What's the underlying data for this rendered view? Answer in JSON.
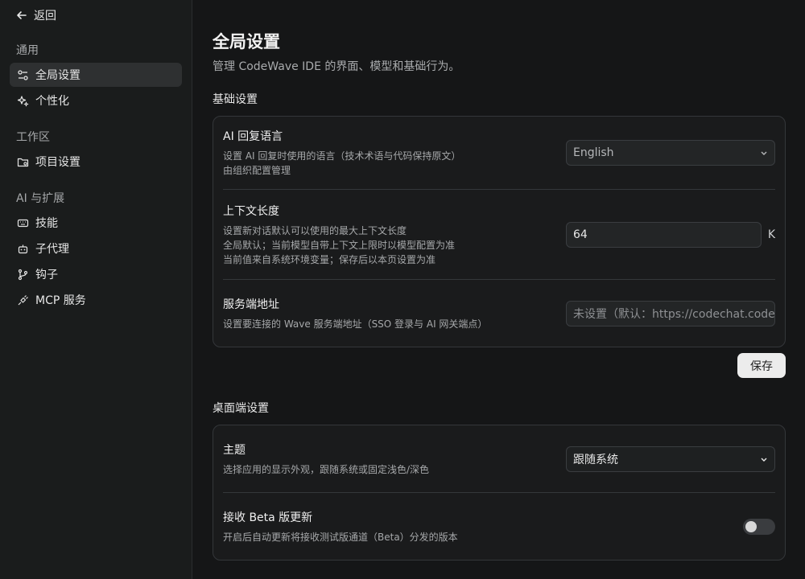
{
  "sidebar": {
    "back_label": "返回",
    "groups": [
      {
        "title": "通用",
        "items": [
          {
            "label": "全局设置",
            "icon": "sliders-icon"
          },
          {
            "label": "个性化",
            "icon": "sparkle-icon"
          }
        ]
      },
      {
        "title": "工作区",
        "items": [
          {
            "label": "项目设置",
            "icon": "folder-gear-icon"
          }
        ]
      },
      {
        "title": "AI 与扩展",
        "items": [
          {
            "label": "技能",
            "icon": "keyboard-icon"
          },
          {
            "label": "子代理",
            "icon": "bot-icon"
          },
          {
            "label": "钩子",
            "icon": "git-branch-icon"
          },
          {
            "label": "MCP 服务",
            "icon": "plug-icon"
          }
        ]
      }
    ]
  },
  "main": {
    "title": "全局设置",
    "subtitle": "管理 CodeWave IDE 的界面、模型和基础行为。",
    "basic": {
      "title": "基础设置",
      "ai_language": {
        "label": "AI 回复语言",
        "desc1": "设置 AI 回复时使用的语言（技术术语与代码保持原文）",
        "desc2": "由组织配置管理",
        "value": "English"
      },
      "context_length": {
        "label": "上下文长度",
        "desc1": "设置新对话默认可以使用的最大上下文长度",
        "desc2": "全局默认；当前模型自带上下文上限时以模型配置为准",
        "desc3": "当前值来自系统环境变量；保存后以本页设置为准",
        "value": "64",
        "unit": "K"
      },
      "server_url": {
        "label": "服务端地址",
        "desc": "设置要连接的 Wave 服务端地址（SSO 登录与 AI 网关端点）",
        "placeholder": "未设置（默认：https://codechat.codew"
      },
      "save_label": "保存"
    },
    "desktop": {
      "title": "桌面端设置",
      "theme": {
        "label": "主题",
        "desc": "选择应用的显示外观，跟随系统或固定浅色/深色",
        "value": "跟随系统"
      },
      "beta": {
        "label": "接收 Beta 版更新",
        "desc": "开启后自动更新将接收测试版通道（Beta）分发的版本",
        "enabled": false
      }
    }
  }
}
